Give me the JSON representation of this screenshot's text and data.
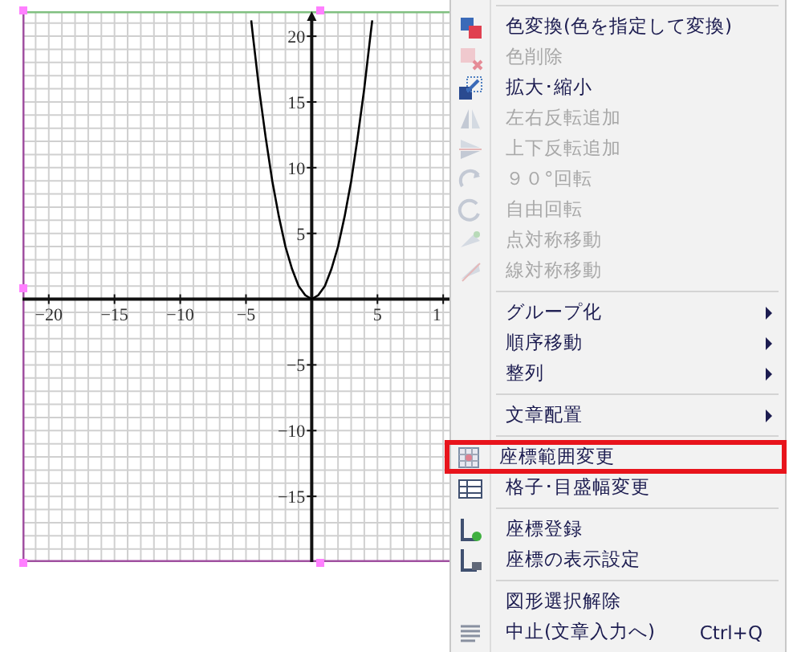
{
  "graph": {
    "cut_tick_label": "1",
    "chart_data": {
      "type": "line",
      "xlim": [
        -22,
        10.6
      ],
      "ylim": [
        -20,
        21.9
      ],
      "xticks": [
        {
          "value": -20,
          "label": "−20"
        },
        {
          "value": -15,
          "label": "−15"
        },
        {
          "value": -10,
          "label": "−10"
        },
        {
          "value": -5,
          "label": "−5"
        },
        {
          "value": 5,
          "label": "5"
        }
      ],
      "grid": true,
      "yticks": [
        {
          "value": 20,
          "label": "20"
        },
        {
          "value": 15,
          "label": "15"
        },
        {
          "value": 10,
          "label": "10"
        },
        {
          "value": 5,
          "label": "5"
        },
        {
          "value": -5,
          "label": "−5"
        },
        {
          "value": -10,
          "label": "−10"
        },
        {
          "value": -15,
          "label": "−15"
        }
      ],
      "x": [
        -4.6,
        -4.5,
        -4,
        -3.5,
        -3,
        -2.5,
        -2,
        -1.5,
        -1,
        -0.5,
        0,
        0.5,
        1,
        1.5,
        2,
        2.5,
        3,
        3.5,
        4,
        4.5,
        4.6
      ],
      "series": [
        {
          "color": "#000000",
          "values": [
            21.2,
            20.3,
            16,
            12.3,
            9,
            6.3,
            4,
            2.3,
            1,
            0.3,
            0,
            0.3,
            1,
            2.3,
            4,
            6.3,
            9,
            12.3,
            16,
            20.3,
            21.2
          ]
        }
      ]
    }
  },
  "context_menu": {
    "items": [
      {
        "kind": "separator"
      },
      {
        "kind": "item",
        "label": "色変換(色を指定して変換)",
        "disabled": false,
        "highlighted": false
      },
      {
        "kind": "item",
        "label": "色削除",
        "disabled": true,
        "highlighted": false
      },
      {
        "kind": "item",
        "label": "拡大･縮小",
        "disabled": false,
        "highlighted": false
      },
      {
        "kind": "item",
        "label": "左右反転追加",
        "disabled": true,
        "highlighted": false
      },
      {
        "kind": "item",
        "label": "上下反転追加",
        "disabled": true,
        "highlighted": false
      },
      {
        "kind": "item",
        "label": "９０°回転",
        "disabled": true,
        "highlighted": false
      },
      {
        "kind": "item",
        "label": "自由回転",
        "disabled": true,
        "highlighted": false
      },
      {
        "kind": "item",
        "label": "点対称移動",
        "disabled": true,
        "highlighted": false
      },
      {
        "kind": "item",
        "label": "線対称移動",
        "disabled": true,
        "highlighted": false
      },
      {
        "kind": "separator"
      },
      {
        "kind": "submenu",
        "label": "グループ化",
        "disabled": false,
        "highlighted": false
      },
      {
        "kind": "submenu",
        "label": "順序移動",
        "disabled": false,
        "highlighted": false
      },
      {
        "kind": "submenu",
        "label": "整列",
        "disabled": false,
        "highlighted": false
      },
      {
        "kind": "separator"
      },
      {
        "kind": "submenu",
        "label": "文章配置",
        "disabled": false,
        "highlighted": false
      },
      {
        "kind": "separator"
      },
      {
        "kind": "item",
        "label": "座標範囲変更",
        "disabled": false,
        "highlighted": true
      },
      {
        "kind": "item",
        "label": "格子･目盛幅変更",
        "disabled": false,
        "highlighted": false
      },
      {
        "kind": "separator"
      },
      {
        "kind": "item",
        "label": "座標登録",
        "disabled": false,
        "highlighted": false
      },
      {
        "kind": "item",
        "label": "座標の表示設定",
        "disabled": false,
        "highlighted": false
      },
      {
        "kind": "separator"
      },
      {
        "kind": "item",
        "label": "図形選択解除",
        "disabled": false,
        "highlighted": false
      },
      {
        "kind": "item",
        "label": "中止(文章入力へ)",
        "shortcut": "Ctrl+Q",
        "disabled": false,
        "highlighted": false
      }
    ]
  }
}
